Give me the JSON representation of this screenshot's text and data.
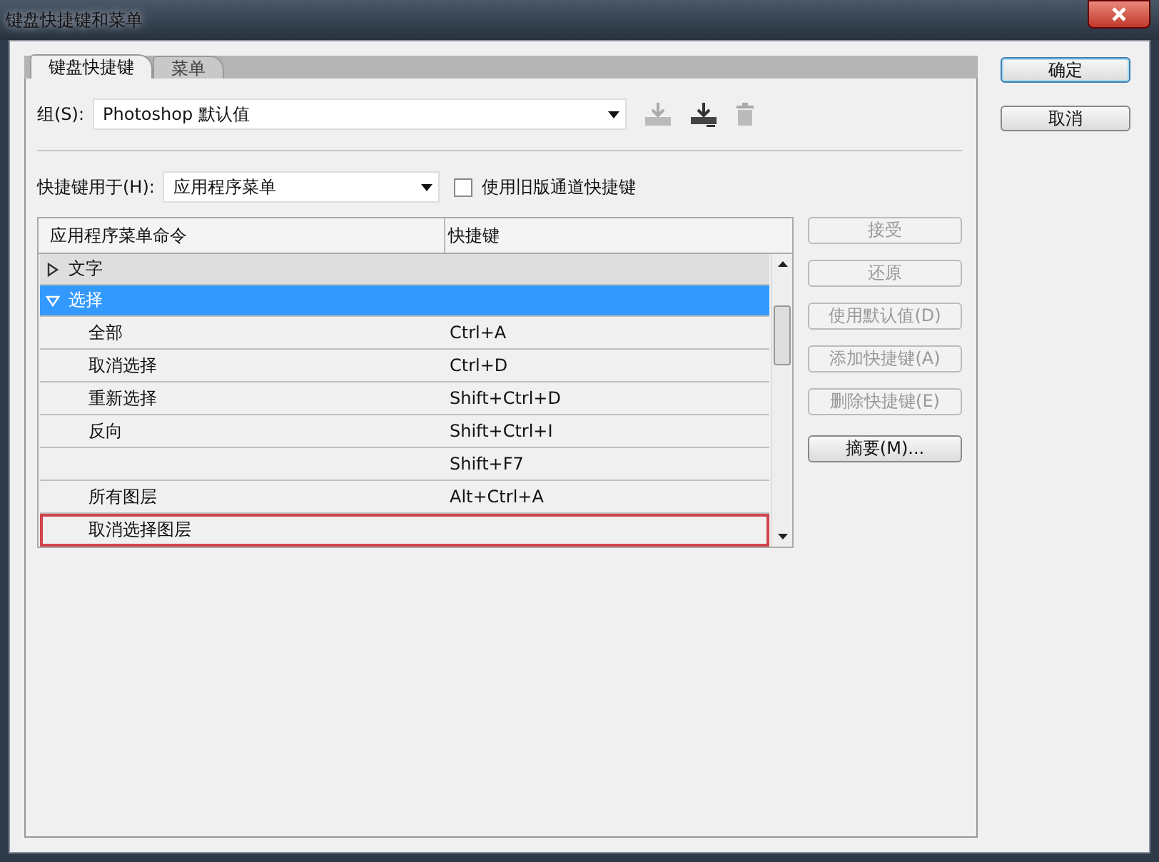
{
  "window": {
    "title": "键盘快捷键和菜单"
  },
  "tabs": [
    {
      "label": "键盘快捷键",
      "selected": true
    },
    {
      "label": "菜单",
      "selected": false
    }
  ],
  "set": {
    "label": "组(S):",
    "value": "Photoshop 默认值"
  },
  "shortcuts_for": {
    "label": "快捷键用于(H):",
    "value": "应用程序菜单"
  },
  "legacy_channels": {
    "label": "使用旧版通道快捷键",
    "checked": false
  },
  "table": {
    "columns": [
      "应用程序菜单命令",
      "快捷键"
    ],
    "rows": [
      {
        "label": "文字",
        "expanded": false,
        "selected": false,
        "children": []
      },
      {
        "label": "选择",
        "expanded": true,
        "selected": true,
        "children": [
          {
            "command": "全部",
            "shortcut": "Ctrl+A",
            "highlighted": false
          },
          {
            "command": "取消选择",
            "shortcut": "Ctrl+D",
            "highlighted": false
          },
          {
            "command": "重新选择",
            "shortcut": "Shift+Ctrl+D",
            "highlighted": false
          },
          {
            "command": "反向",
            "shortcut": "Shift+Ctrl+I",
            "highlighted": false
          },
          {
            "shortcut": "Shift+F7",
            "highlighted": false
          },
          {
            "command": "所有图层",
            "shortcut": "Alt+Ctrl+A",
            "highlighted": false
          },
          {
            "command": "取消选择图层",
            "highlighted": true
          }
        ]
      }
    ]
  },
  "side_buttons": [
    {
      "label": "接受",
      "disabled": true
    },
    {
      "label": "还原",
      "disabled": true
    },
    {
      "label": "使用默认值(D)",
      "disabled": true
    },
    {
      "label": "添加快捷键(A)",
      "disabled": true
    },
    {
      "label": "删除快捷键(E)",
      "disabled": true
    },
    {
      "label": "摘要(M)...",
      "disabled": false
    }
  ],
  "dialog_buttons": [
    {
      "label": "确定",
      "selected": true
    },
    {
      "label": "取消",
      "selected": false
    }
  ]
}
